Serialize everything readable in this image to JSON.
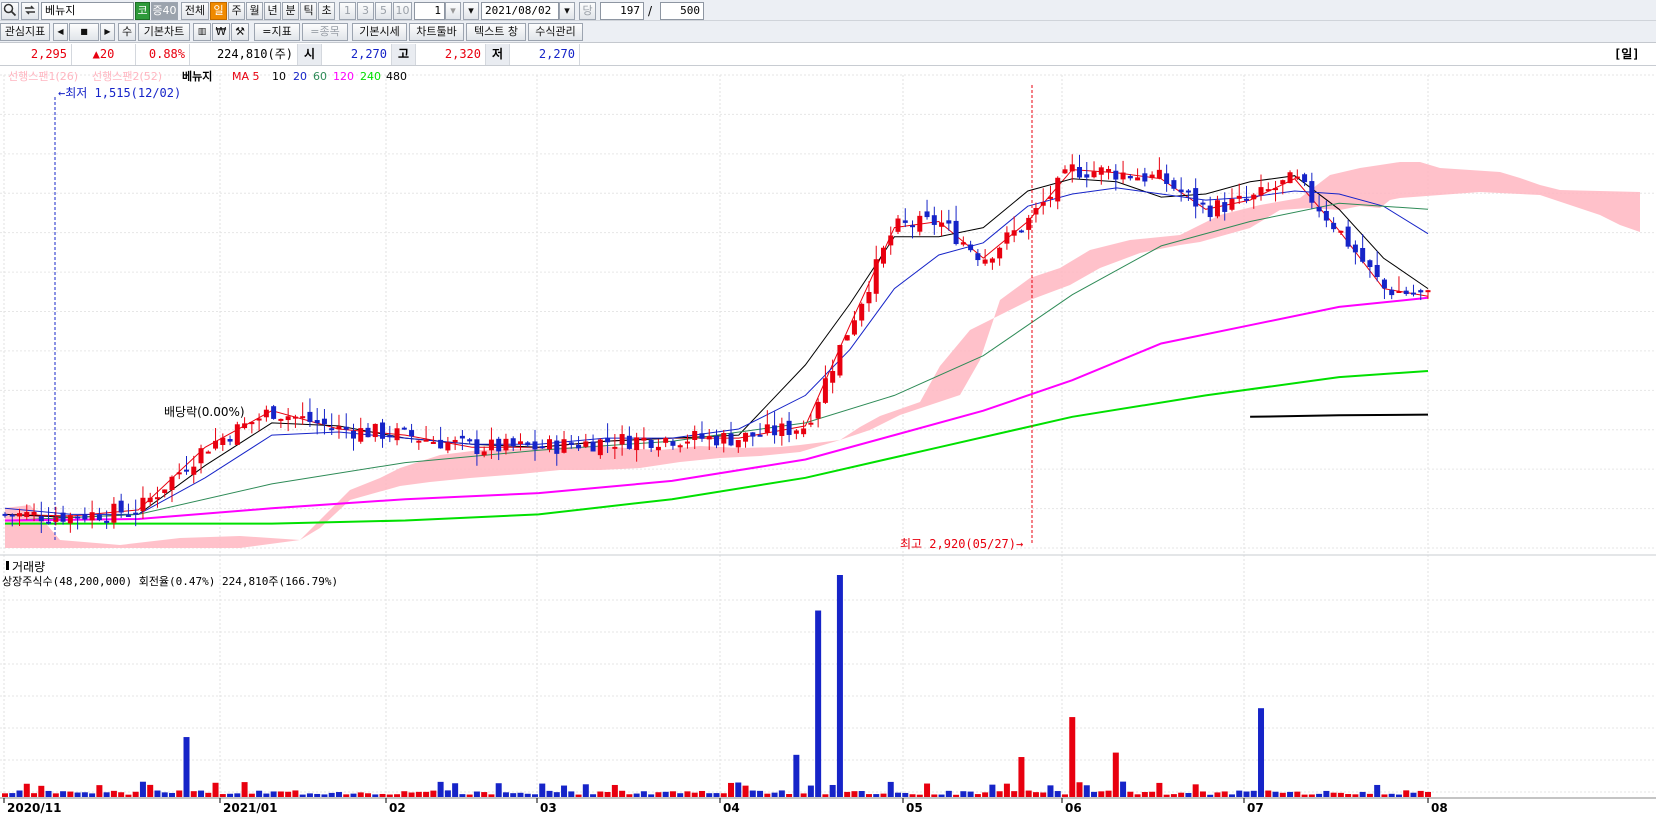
{
  "toolbar": {
    "stock_name": "베뉴지",
    "market_badge": "코",
    "margin_badge": "증40",
    "period_all": "전체",
    "period_day": "일",
    "period_week": "주",
    "period_month": "월",
    "period_year": "년",
    "period_minute": "분",
    "period_tick": "틱",
    "period_second": "초",
    "interval_1": "1",
    "interval_3": "3",
    "interval_5": "5",
    "interval_10": "10",
    "interval_value": "1",
    "date_value": "2021/08/02",
    "dang_label": "당",
    "count_value": "197",
    "count_sep": "/",
    "total_value": "500",
    "watchlist_label": "관심지표",
    "scroll_left": "◀",
    "scroll_mid": "■",
    "scroll_right": "▶",
    "su_label": "수",
    "basic_chart": "기본차트",
    "indicator_label": "=지표",
    "stock_label": "=종목",
    "basic_quote": "기본시세",
    "chart_toolbar": "차트툴바",
    "text_window": "텍스트 창",
    "formula_mgmt": "수식관리"
  },
  "pricebar": {
    "current": "2,295",
    "change": "▲20",
    "change_pct": "0.88%",
    "volume": "224,810(주)",
    "open_label": "시",
    "open": "2,270",
    "high_label": "고",
    "high": "2,320",
    "low_label": "저",
    "low": "2,270",
    "period_badge": "[일]"
  },
  "legend": {
    "span1": "선행스팬1(26)",
    "span2": "선행스팬2(52)",
    "stock": "베뉴지",
    "ma_label": "MA 5",
    "ma10": "10",
    "ma20": "20",
    "ma60": "60",
    "ma120": "120",
    "ma240": "240",
    "ma480": "480"
  },
  "annotations": {
    "low_marker": "최저 1,515(12/02)",
    "high_marker": "최고 2,920(05/27)",
    "dividend": "배당락(0.00%)"
  },
  "volume_panel": {
    "title": "거래량",
    "info": "상장주식수(48,200,000) 회전율(0.47%) 224,810주(166.79%)"
  },
  "colors": {
    "up": "#e8000f",
    "down": "#1624c8",
    "ma5": "#e8000f",
    "ma10": "#000000",
    "ma20": "#1624c8",
    "ma60": "#2e8b57",
    "ma120": "#ff00ff",
    "ma240": "#00e000",
    "ma480": "#000000",
    "cloud": "#ffb6c1"
  },
  "chart_data": {
    "type": "candlestick",
    "title": "베뉴지",
    "x_ticks": [
      "2020/11",
      "2021/01",
      "02",
      "03",
      "04",
      "05",
      "06",
      "07",
      "08"
    ],
    "ylim": [
      1450,
      3000
    ],
    "grid": true,
    "series": [
      {
        "name": "MA 5",
        "points": [
          [
            0,
            1560
          ],
          [
            30,
            1555
          ],
          [
            60,
            1575
          ],
          [
            90,
            1780
          ],
          [
            120,
            1900
          ],
          [
            150,
            1840
          ],
          [
            180,
            1820
          ],
          [
            210,
            1780
          ],
          [
            240,
            1780
          ],
          [
            270,
            1800
          ],
          [
            300,
            1810
          ],
          [
            330,
            1810
          ],
          [
            360,
            1850
          ],
          [
            380,
            2180
          ],
          [
            400,
            2500
          ],
          [
            420,
            2520
          ],
          [
            440,
            2400
          ],
          [
            460,
            2520
          ],
          [
            480,
            2690
          ],
          [
            500,
            2680
          ],
          [
            520,
            2660
          ],
          [
            540,
            2560
          ],
          [
            560,
            2590
          ],
          [
            580,
            2660
          ],
          [
            600,
            2490
          ],
          [
            620,
            2300
          ],
          [
            640,
            2275
          ]
        ]
      },
      {
        "name": "MA 10",
        "points": [
          [
            0,
            1560
          ],
          [
            30,
            1550
          ],
          [
            60,
            1560
          ],
          [
            90,
            1720
          ],
          [
            120,
            1860
          ],
          [
            150,
            1850
          ],
          [
            180,
            1810
          ],
          [
            210,
            1790
          ],
          [
            240,
            1780
          ],
          [
            270,
            1800
          ],
          [
            300,
            1810
          ],
          [
            330,
            1820
          ],
          [
            360,
            2050
          ],
          [
            380,
            2250
          ],
          [
            400,
            2470
          ],
          [
            420,
            2470
          ],
          [
            440,
            2500
          ],
          [
            460,
            2620
          ],
          [
            480,
            2660
          ],
          [
            500,
            2650
          ],
          [
            520,
            2600
          ],
          [
            540,
            2610
          ],
          [
            560,
            2650
          ],
          [
            580,
            2670
          ],
          [
            600,
            2560
          ],
          [
            620,
            2400
          ],
          [
            640,
            2300
          ]
        ]
      },
      {
        "name": "MA 20",
        "points": [
          [
            0,
            1580
          ],
          [
            30,
            1560
          ],
          [
            60,
            1560
          ],
          [
            90,
            1680
          ],
          [
            120,
            1820
          ],
          [
            150,
            1830
          ],
          [
            180,
            1810
          ],
          [
            210,
            1790
          ],
          [
            240,
            1790
          ],
          [
            270,
            1810
          ],
          [
            300,
            1810
          ],
          [
            330,
            1840
          ],
          [
            360,
            1950
          ],
          [
            380,
            2100
          ],
          [
            400,
            2300
          ],
          [
            420,
            2410
          ],
          [
            440,
            2450
          ],
          [
            460,
            2570
          ],
          [
            480,
            2610
          ],
          [
            500,
            2630
          ],
          [
            520,
            2610
          ],
          [
            540,
            2590
          ],
          [
            560,
            2600
          ],
          [
            580,
            2620
          ],
          [
            600,
            2610
          ],
          [
            620,
            2570
          ],
          [
            640,
            2480
          ]
        ]
      },
      {
        "name": "MA 60",
        "points": [
          [
            0,
            1540
          ],
          [
            60,
            1560
          ],
          [
            120,
            1660
          ],
          [
            180,
            1730
          ],
          [
            240,
            1770
          ],
          [
            300,
            1800
          ],
          [
            360,
            1860
          ],
          [
            400,
            1950
          ],
          [
            440,
            2080
          ],
          [
            480,
            2280
          ],
          [
            520,
            2440
          ],
          [
            560,
            2520
          ],
          [
            600,
            2580
          ],
          [
            640,
            2560
          ]
        ]
      },
      {
        "name": "MA 120",
        "points": [
          [
            0,
            1540
          ],
          [
            60,
            1545
          ],
          [
            120,
            1580
          ],
          [
            180,
            1610
          ],
          [
            240,
            1630
          ],
          [
            300,
            1670
          ],
          [
            360,
            1740
          ],
          [
            400,
            1820
          ],
          [
            440,
            1900
          ],
          [
            480,
            2000
          ],
          [
            520,
            2120
          ],
          [
            560,
            2180
          ],
          [
            600,
            2240
          ],
          [
            640,
            2270
          ]
        ]
      },
      {
        "name": "MA 240",
        "points": [
          [
            0,
            1530
          ],
          [
            120,
            1530
          ],
          [
            180,
            1540
          ],
          [
            240,
            1560
          ],
          [
            300,
            1610
          ],
          [
            360,
            1680
          ],
          [
            420,
            1780
          ],
          [
            480,
            1880
          ],
          [
            540,
            1950
          ],
          [
            600,
            2010
          ],
          [
            640,
            2030
          ]
        ]
      },
      {
        "name": "MA 480",
        "points": [
          [
            560,
            1880
          ],
          [
            600,
            1885
          ],
          [
            640,
            1887
          ]
        ]
      }
    ],
    "volume": {
      "title": "거래량",
      "spikes": [
        {
          "x": 82,
          "value": 0.23
        },
        {
          "x": 355,
          "value": 0.19
        },
        {
          "x": 366,
          "value": 0.8
        },
        {
          "x": 374,
          "value": 1.0
        },
        {
          "x": 458,
          "value": 0.18
        },
        {
          "x": 480,
          "value": 0.36
        },
        {
          "x": 500,
          "value": 0.2
        },
        {
          "x": 565,
          "value": 0.36
        }
      ]
    }
  }
}
